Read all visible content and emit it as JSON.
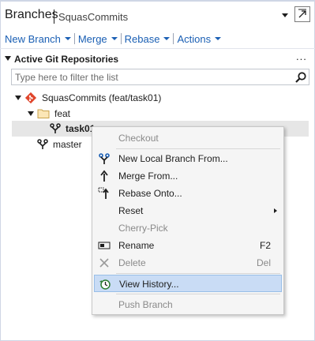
{
  "header": {
    "title": "Branches",
    "repo": "SquasCommits"
  },
  "toolbar": {
    "items": [
      {
        "label": "New Branch"
      },
      {
        "label": "Merge"
      },
      {
        "label": "Rebase"
      },
      {
        "label": "Actions"
      }
    ]
  },
  "section": {
    "label": "Active Git Repositories",
    "more": "..."
  },
  "filter": {
    "placeholder": "Type here to filter the list",
    "value": ""
  },
  "tree": {
    "repo": "SquasCommits (feat/task01)",
    "folder": "feat",
    "current_branch": "task01",
    "branch_master": "master"
  },
  "context_menu": {
    "checkout": "Checkout",
    "new_local_branch": "New Local Branch From...",
    "merge_from": "Merge From...",
    "rebase_onto": "Rebase Onto...",
    "reset": "Reset",
    "cherry_pick": "Cherry-Pick",
    "rename": "Rename",
    "rename_shortcut": "F2",
    "delete": "Delete",
    "delete_shortcut": "Del",
    "view_history": "View History...",
    "push_branch": "Push Branch"
  },
  "colors": {
    "link": "#1a5fb4",
    "hover": "#c9dcf5",
    "git_logo": "#e0452b"
  }
}
